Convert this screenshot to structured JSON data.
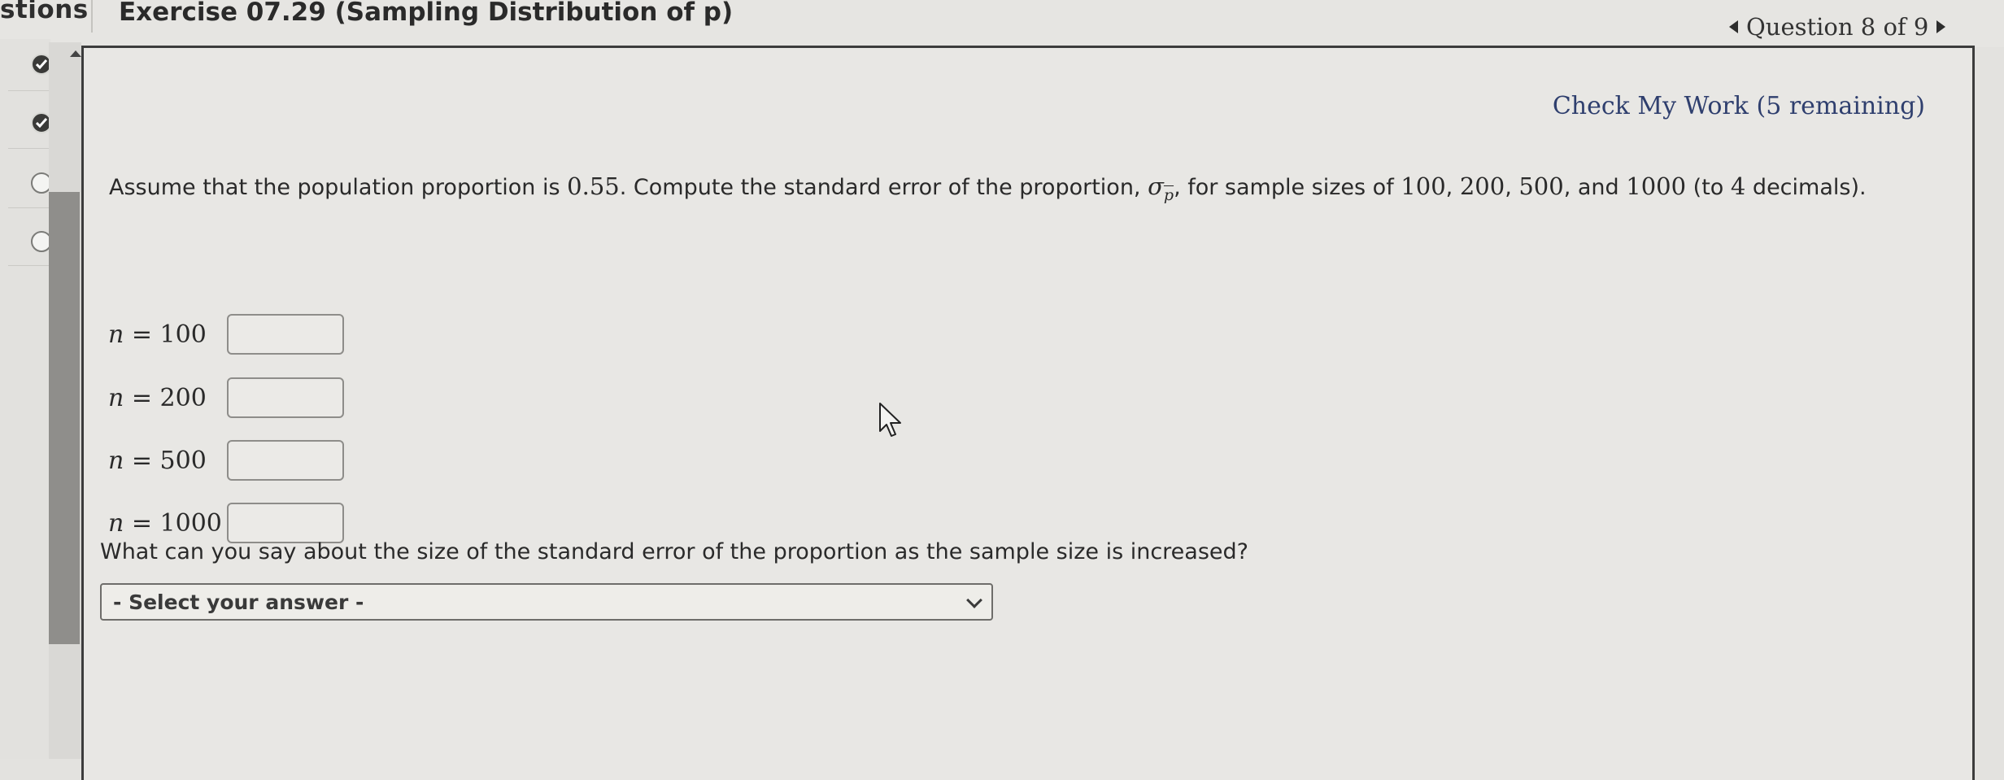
{
  "header": {
    "left_tab_title": "stions",
    "exercise_title": "Exercise 07.29 (Sampling Distribution of p)",
    "question_nav": "Question 8 of 9"
  },
  "sidebar": {
    "indicators": [
      {
        "status": "done"
      },
      {
        "status": "done"
      },
      {
        "status": "open"
      },
      {
        "status": "open"
      }
    ]
  },
  "main": {
    "check_my_work": "Check My Work (5 remaining)",
    "prompt": {
      "p1": "Assume that the population proportion is ",
      "pop_value": "0.55",
      "p2": ". Compute the standard error of the proportion, ",
      "sigma": "σ",
      "sigma_sub": "p",
      "p3": ", for sample sizes of ",
      "s1": "100",
      "c1": ", ",
      "s2": "200",
      "c2": ", ",
      "s3": "500",
      "c3": ", and ",
      "s4": "1000",
      "p4": " (to ",
      "decimals": "4",
      "p5": " decimals)."
    },
    "n_symbol": "n",
    "eq": " = ",
    "rows": [
      {
        "n": "100"
      },
      {
        "n": "200"
      },
      {
        "n": "500"
      },
      {
        "n": "1000"
      }
    ],
    "question2": "What can you say about the size of the standard error of the proportion as the sample size is increased?",
    "select_placeholder": "- Select your answer -"
  },
  "icons": {
    "indicator_done": "checkmark-icon",
    "indicator_open": "empty-circle-icon",
    "nav_prev": "triangle-left-icon",
    "nav_next": "triangle-right-icon",
    "dropdown": "chevron-down-icon",
    "cursor": "mouse-pointer-icon"
  }
}
